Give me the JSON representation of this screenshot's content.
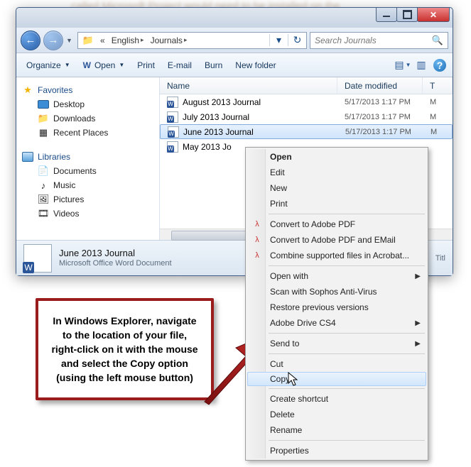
{
  "bg_text": "called Microsoft Project would need to be installed on the",
  "breadcrumb": {
    "root": "«",
    "seg1": "English",
    "seg2": "Journals"
  },
  "search": {
    "placeholder": "Search Journals"
  },
  "toolbar": {
    "organize": "Organize",
    "open": "Open",
    "print": "Print",
    "email": "E-mail",
    "burn": "Burn",
    "newfolder": "New folder"
  },
  "nav": {
    "favorites": "Favorites",
    "desktop": "Desktop",
    "downloads": "Downloads",
    "recent": "Recent Places",
    "libraries": "Libraries",
    "documents": "Documents",
    "music": "Music",
    "pictures": "Pictures",
    "videos": "Videos"
  },
  "cols": {
    "name": "Name",
    "date": "Date modified",
    "type": "T"
  },
  "files": {
    "f0": {
      "name": "August 2013 Journal",
      "date": "5/17/2013 1:17 PM",
      "type": "M"
    },
    "f1": {
      "name": "July 2013 Journal",
      "date": "5/17/2013 1:17 PM",
      "type": "M"
    },
    "f2": {
      "name": "June 2013 Journal",
      "date": "5/17/2013 1:17 PM",
      "type": "M"
    },
    "f3": {
      "name": "May 2013 Jo",
      "date": "",
      "type": ""
    }
  },
  "details": {
    "title": "June 2013 Journal",
    "sub": "Microsoft Office Word Document",
    "right": "Titl"
  },
  "menu": {
    "open": "Open",
    "edit": "Edit",
    "new": "New",
    "print": "Print",
    "pdf": "Convert to Adobe PDF",
    "pdfemail": "Convert to Adobe PDF and EMail",
    "acrobat": "Combine supported files in Acrobat...",
    "openwith": "Open with",
    "sophos": "Scan with Sophos Anti-Virus",
    "restore": "Restore previous versions",
    "cs4": "Adobe Drive CS4",
    "sendto": "Send to",
    "cut": "Cut",
    "copy": "Copy",
    "shortcut": "Create shortcut",
    "delete": "Delete",
    "rename": "Rename",
    "properties": "Properties"
  },
  "callout": "In Windows Explorer, navigate to the location of your file, right-click on it with the mouse and select the Copy option (using the left mouse button)"
}
